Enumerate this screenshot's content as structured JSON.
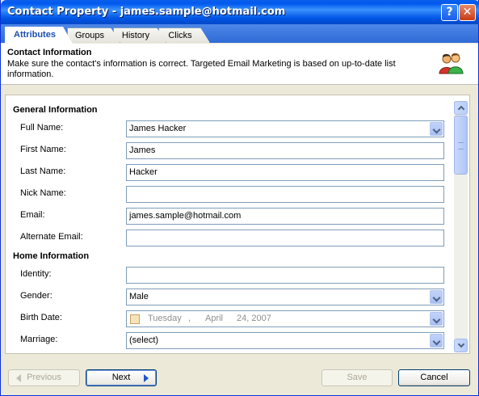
{
  "window": {
    "title": "Contact Property - james.sample@hotmail.com",
    "help_label": "?",
    "close_label": "✕"
  },
  "tabs": [
    {
      "label": "Attributes",
      "active": true
    },
    {
      "label": "Groups",
      "active": false
    },
    {
      "label": "History",
      "active": false
    },
    {
      "label": "Clicks",
      "active": false
    }
  ],
  "header": {
    "title": "Contact Information",
    "description": "Make sure the contact's information is correct. Targeted Email Marketing is based on up-to-date list information.",
    "icon": "contacts-icon"
  },
  "general": {
    "title": "General Information",
    "full_name": {
      "label": "Full Name:",
      "value": "James Hacker"
    },
    "first_name": {
      "label": "First Name:",
      "value": "James"
    },
    "last_name": {
      "label": "Last Name:",
      "value": "Hacker"
    },
    "nick_name": {
      "label": "Nick Name:",
      "value": ""
    },
    "email": {
      "label": "Email:",
      "value": "james.sample@hotmail.com"
    },
    "alternate_email": {
      "label": "Alternate Email:",
      "value": ""
    }
  },
  "home": {
    "title": "Home Information",
    "identity": {
      "label": "Identity:",
      "value": ""
    },
    "gender": {
      "label": "Gender:",
      "value": "Male"
    },
    "birth_date": {
      "label": "Birth Date:",
      "weekday": "Tuesday",
      "sep": ",",
      "month": "April",
      "day_year": "24, 2007"
    },
    "marriage": {
      "label": "Marriage:",
      "value": "(select)"
    }
  },
  "footer": {
    "previous_label": "Previous",
    "next_label": "Next",
    "save_label": "Save",
    "cancel_label": "Cancel"
  },
  "colors": {
    "title_bar": "#0058ee",
    "tab_strip": "#3a74de",
    "active_tab_text": "#1c4fb0"
  }
}
